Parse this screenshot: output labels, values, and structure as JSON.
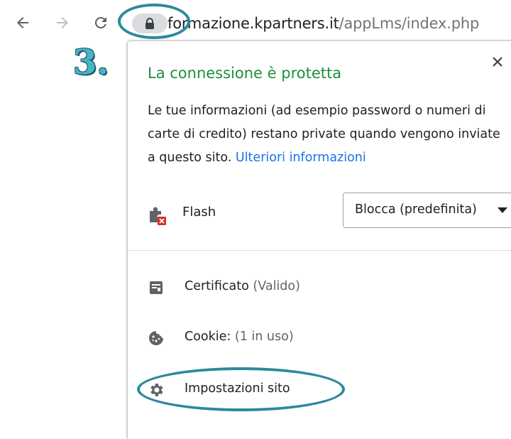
{
  "browser": {
    "url_host": "formazione.kpartners.it",
    "url_path": "/appLms/index.php",
    "icons": {
      "back": "arrow-left-icon",
      "forward": "arrow-right-icon",
      "reload": "reload-icon",
      "lock": "lock-icon"
    }
  },
  "annotation": {
    "step_number": "3.",
    "color": "#2b8a9b"
  },
  "popup": {
    "title": "La connessione è protetta",
    "title_color": "#1e8e3e",
    "description": "Le tue informazioni (ad esempio password o numeri di carte di credito) restano private quando vengono inviate a questo sito.",
    "more_info_link": "Ulteriori informazioni",
    "link_color": "#1a73e8",
    "permission": {
      "label": "Flash",
      "icon": "puzzle-blocked-icon",
      "select_value": "Blocca (predefinita)"
    },
    "menu": [
      {
        "label": "Certificato",
        "sub": "(Valido)",
        "icon": "certificate-icon"
      },
      {
        "label": "Cookie:",
        "sub": "(1 in uso)",
        "icon": "cookie-icon"
      },
      {
        "label": "Impostazioni sito",
        "sub": "",
        "icon": "gear-icon"
      }
    ]
  }
}
